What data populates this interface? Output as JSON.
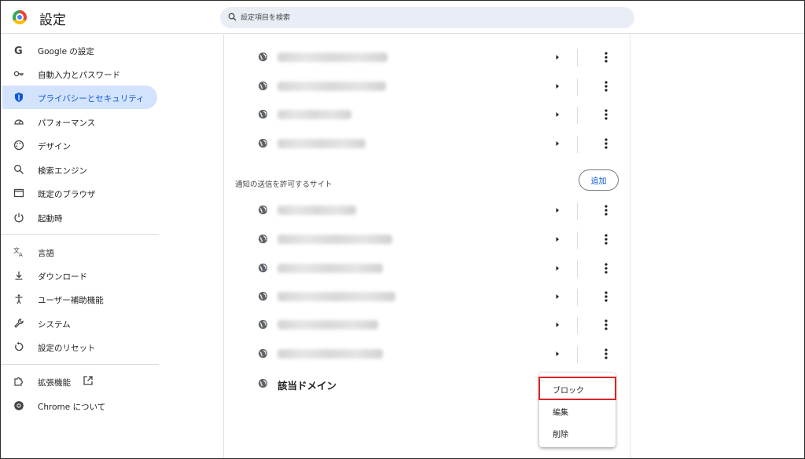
{
  "header": {
    "title": "設定",
    "search_placeholder": "設定項目を検索",
    "logo_icon": "chrome-logo-icon"
  },
  "sidebar": {
    "items": [
      {
        "label": "Google の設定",
        "icon": "google-icon"
      },
      {
        "label": "自動入力とパスワード",
        "icon": "key-icon"
      },
      {
        "label": "プライバシーとセキュリティ",
        "icon": "shield-icon",
        "active": true
      },
      {
        "label": "パフォーマンス",
        "icon": "speedometer-icon"
      },
      {
        "label": "デザイン",
        "icon": "palette-icon"
      },
      {
        "label": "検索エンジン",
        "icon": "search-icon"
      },
      {
        "label": "既定のブラウザ",
        "icon": "browser-window-icon"
      },
      {
        "label": "起動時",
        "icon": "power-icon"
      },
      {
        "label": "言語",
        "icon": "translate-icon"
      },
      {
        "label": "ダウンロード",
        "icon": "download-icon"
      },
      {
        "label": "ユーザー補助機能",
        "icon": "accessibility-icon"
      },
      {
        "label": "システム",
        "icon": "wrench-icon"
      },
      {
        "label": "設定のリセット",
        "icon": "reset-icon"
      },
      {
        "label": "拡張機能",
        "icon": "puzzle-icon"
      },
      {
        "label": "Chrome について",
        "icon": "chrome-icon"
      }
    ],
    "active_color": "#d3e3fd",
    "active_text_color": "#0b57d0"
  },
  "main": {
    "section_title": "通知の送信を許可するサイト",
    "add_label": "追加",
    "domain_label": "該当ドメイン",
    "blurred_site_count_top": 4,
    "blurred_site_count_allowed": 6
  },
  "menu": {
    "items": [
      "ブロック",
      "編集",
      "削除"
    ],
    "highlight_color": "#e02424"
  }
}
